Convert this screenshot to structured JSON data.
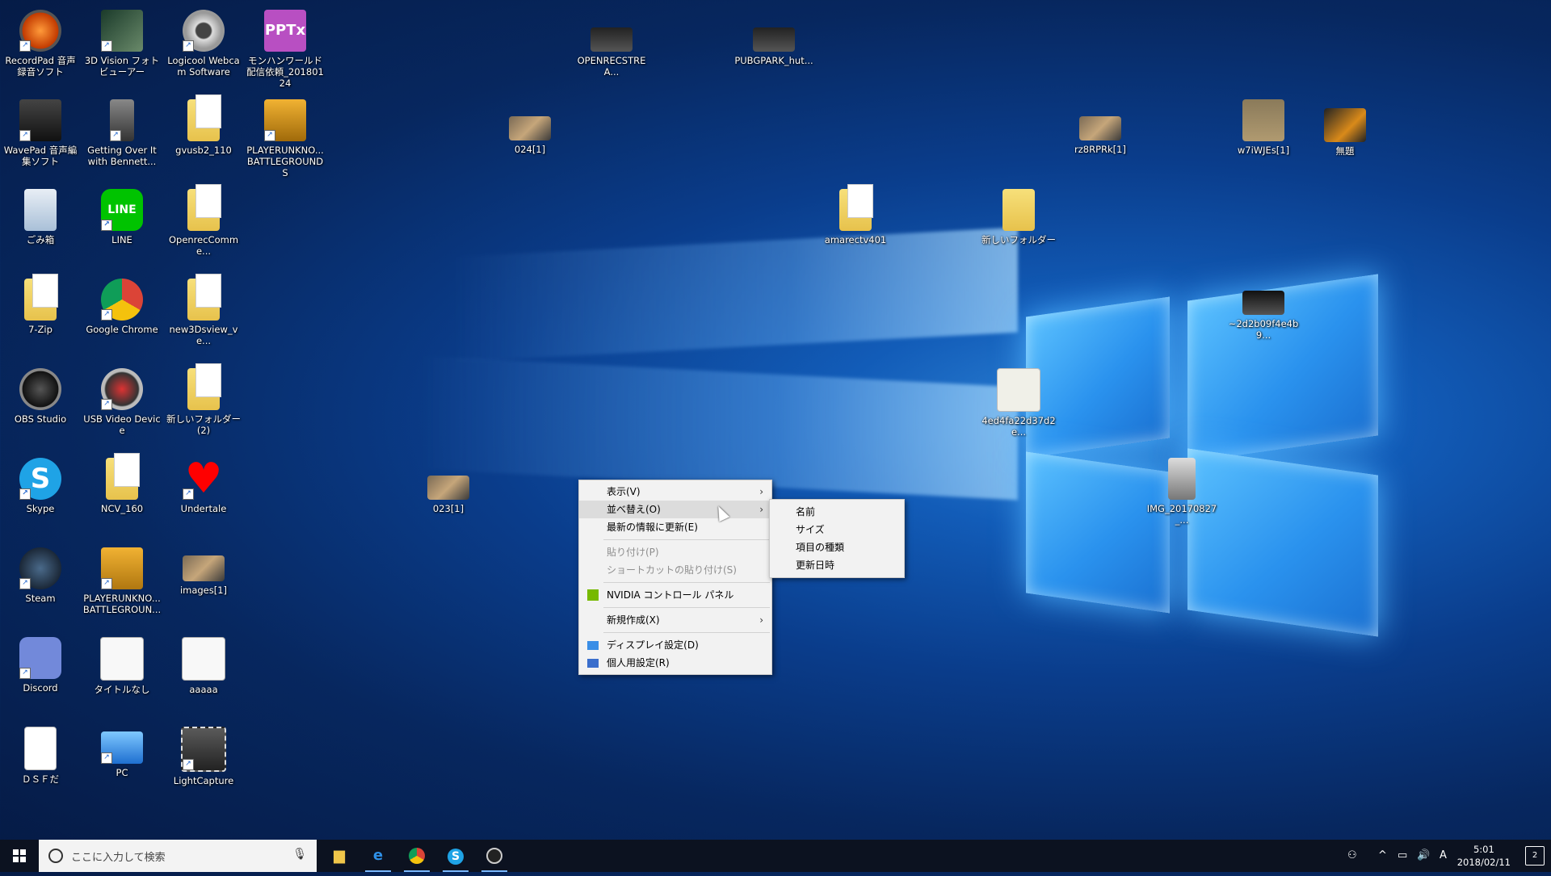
{
  "desktop_icons": {
    "recordpad": "RecordPad 音声録音ソフト",
    "vision3d": "3D Vision フォトビューアー",
    "logicool": "Logicool Webcam Software",
    "monhan": "モンハンワールド配信依頼_20180124",
    "openrec_stream": "OPENRECSTREA...",
    "pubgpark": "PUBGPARK_hut...",
    "wavepad": "WavePad 音声編集ソフト",
    "getting_over": "Getting Over It with Bennett...",
    "gvusb": "gvusb2_110",
    "pubg1": "PLAYERUNKNO... BATTLEGROUNDS",
    "img024": "024[1]",
    "rz8rpk": "rz8RPRk[1]",
    "w7iwjes": "w7iWJEs[1]",
    "untitled": "無題",
    "trash": "ごみ箱",
    "line": "LINE",
    "openrec_comment": "OpenrecComme...",
    "amarectv": "amarectv401",
    "new_folder": "新しいフォルダー",
    "zip7": "7-Zip",
    "chrome": "Google Chrome",
    "new3ds": "new3Dsview_ve...",
    "dsc_img": "~2d2b09f4e4b9...",
    "obs": "OBS Studio",
    "usbvideo": "USB Video Device",
    "new_folder2": "新しいフォルダー (2)",
    "img4ed": "4ed4fa22d37d2e...",
    "skype": "Skype",
    "ncv": "NCV_160",
    "undertale": "Undertale",
    "img023": "023[1]",
    "img_photo": "IMG_20170827_...",
    "steam": "Steam",
    "pubg2": "PLAYERUNKNO... BATTLEGROUN...",
    "images1": "images[1]",
    "discord": "Discord",
    "taitoru": "タイトルなし",
    "aaaaa": "aaaaa",
    "dsf": "ＤＳＦだ",
    "pc": "PC",
    "lightcapture": "LightCapture"
  },
  "context_menu": {
    "view": "表示(V)",
    "sort": "並べ替え(O)",
    "refresh": "最新の情報に更新(E)",
    "paste": "貼り付け(P)",
    "paste_shortcut": "ショートカットの貼り付け(S)",
    "nvidia": "NVIDIA コントロール パネル",
    "new": "新規作成(X)",
    "display": "ディスプレイ設定(D)",
    "personalize": "個人用設定(R)"
  },
  "sort_submenu": {
    "name": "名前",
    "size": "サイズ",
    "type": "項目の種類",
    "date": "更新日時"
  },
  "taskbar": {
    "search_placeholder": "ここに入力して検索",
    "time": "5:01",
    "date": "2018/02/11",
    "ime": "A",
    "notifications": "2"
  },
  "colors": {
    "desktop_bg": "#0a3d8c",
    "taskbar": "#0c1220",
    "menu_bg": "#f2f2f2"
  }
}
